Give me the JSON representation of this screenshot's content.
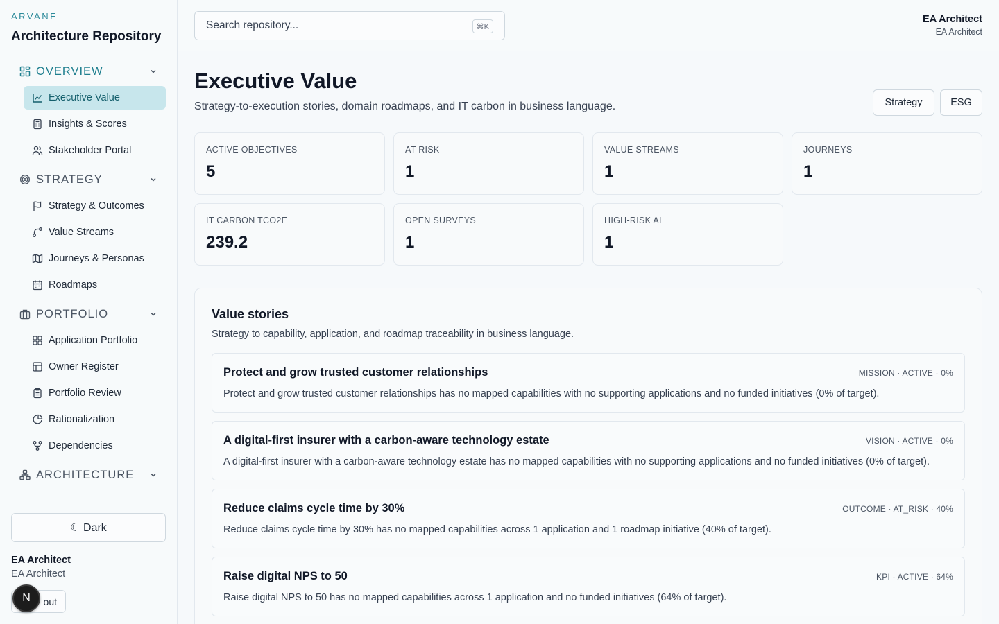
{
  "brand": {
    "small": "ARVANE",
    "title": "Architecture Repository"
  },
  "sidebar": {
    "sections": [
      {
        "label": "OVERVIEW",
        "icon": "dashboard-grid-icon",
        "items": [
          {
            "label": "Executive Value",
            "icon": "line-chart-icon"
          },
          {
            "label": "Insights & Scores",
            "icon": "calculator-icon"
          },
          {
            "label": "Stakeholder Portal",
            "icon": "users-icon"
          }
        ]
      },
      {
        "label": "STRATEGY",
        "icon": "target-icon",
        "items": [
          {
            "label": "Strategy & Outcomes",
            "icon": "flag-icon"
          },
          {
            "label": "Value Streams",
            "icon": "route-icon"
          },
          {
            "label": "Journeys & Personas",
            "icon": "map-icon"
          },
          {
            "label": "Roadmaps",
            "icon": "calendar-icon"
          }
        ]
      },
      {
        "label": "PORTFOLIO",
        "icon": "briefcase-icon",
        "items": [
          {
            "label": "Application Portfolio",
            "icon": "apps-grid-icon"
          },
          {
            "label": "Owner Register",
            "icon": "table-icon"
          },
          {
            "label": "Portfolio Review",
            "icon": "clipboard-icon"
          },
          {
            "label": "Rationalization",
            "icon": "pie-chart-icon"
          },
          {
            "label": "Dependencies",
            "icon": "git-fork-icon"
          }
        ]
      },
      {
        "label": "ARCHITECTURE",
        "icon": "network-icon",
        "items": []
      }
    ],
    "theme_button": "☾ Dark",
    "user_name": "EA Architect",
    "user_role": "EA Architect",
    "signout_label": "out",
    "badge": "N"
  },
  "topbar": {
    "search_placeholder": "Search repository...",
    "search_shortcut": "⌘K",
    "user_name": "EA Architect",
    "user_role": "EA Architect"
  },
  "page": {
    "title": "Executive Value",
    "subtitle": "Strategy-to-execution stories, domain roadmaps, and IT carbon in business language.",
    "buttons": [
      "Strategy",
      "ESG"
    ]
  },
  "stats": [
    {
      "label": "ACTIVE OBJECTIVES",
      "value": "5"
    },
    {
      "label": "AT RISK",
      "value": "1"
    },
    {
      "label": "VALUE STREAMS",
      "value": "1"
    },
    {
      "label": "JOURNEYS",
      "value": "1"
    },
    {
      "label": "IT CARBON TCO2E",
      "value": "239.2"
    },
    {
      "label": "OPEN SURVEYS",
      "value": "1"
    },
    {
      "label": "HIGH-RISK AI",
      "value": "1"
    }
  ],
  "stories": {
    "title": "Value stories",
    "subtitle": "Strategy to capability, application, and roadmap traceability in business language.",
    "items": [
      {
        "title": "Protect and grow trusted customer relationships",
        "meta": "MISSION · ACTIVE · 0%",
        "desc": "Protect and grow trusted customer relationships has no mapped capabilities with no supporting applications and no funded initiatives (0% of target)."
      },
      {
        "title": "A digital-first insurer with a carbon-aware technology estate",
        "meta": "VISION · ACTIVE · 0%",
        "desc": "A digital-first insurer with a carbon-aware technology estate has no mapped capabilities with no supporting applications and no funded initiatives (0% of target)."
      },
      {
        "title": "Reduce claims cycle time by 30%",
        "meta": "OUTCOME · AT_RISK · 40%",
        "desc": "Reduce claims cycle time by 30% has no mapped capabilities across 1 application and 1 roadmap initiative (40% of target)."
      },
      {
        "title": "Raise digital NPS to 50",
        "meta": "KPI · ACTIVE · 64%",
        "desc": "Raise digital NPS to 50 has no mapped capabilities across 1 application and no funded initiatives (64% of target)."
      }
    ]
  },
  "colors": {
    "accent": "#1f7f8f",
    "selected_bg": "#c7e6ec",
    "border": "#e2e8ee"
  }
}
